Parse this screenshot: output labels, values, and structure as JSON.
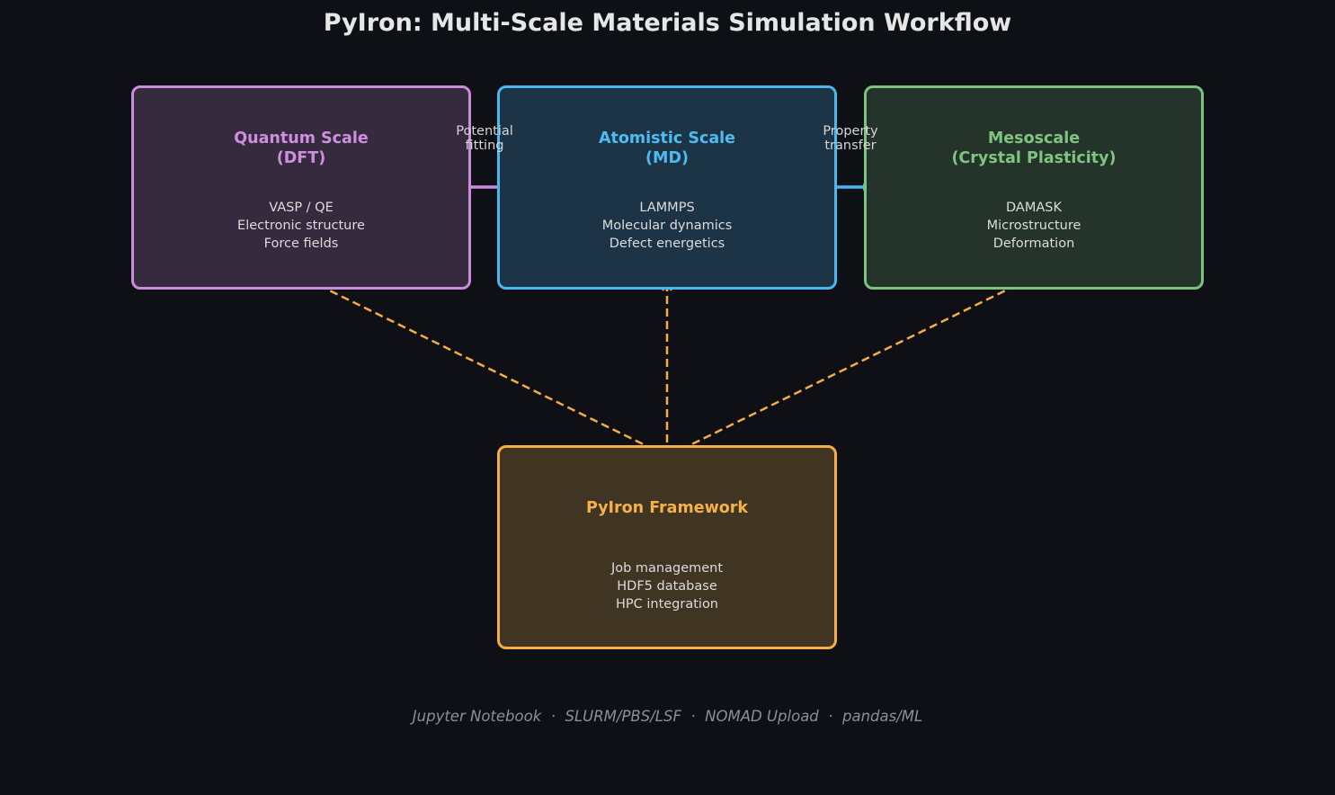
{
  "title": "PyIron: Multi-Scale Materials Simulation Workflow",
  "boxes": {
    "quantum": {
      "name": "Quantum Scale\n(DFT)",
      "lines": [
        "VASP / QE",
        "Electronic structure",
        "Force fields"
      ],
      "color": "#c98ddc"
    },
    "atomistic": {
      "name": "Atomistic Scale\n(MD)",
      "lines": [
        "LAMMPS",
        "Molecular dynamics",
        "Defect energetics"
      ],
      "color": "#48b8f0"
    },
    "meso": {
      "name": "Mesoscale\n(Crystal Plasticity)",
      "lines": [
        "DAMASK",
        "Microstructure",
        "Deformation"
      ],
      "color": "#7cc47e"
    },
    "pyiron": {
      "name": "PyIron Framework",
      "lines": [
        "Job management",
        "HDF5 database",
        "HPC integration"
      ],
      "color": "#f5ad44"
    }
  },
  "edges": {
    "quantum_to_atomistic": {
      "label": "Potential\nfitting"
    },
    "atomistic_to_meso": {
      "label": "Property\ntransfer"
    }
  },
  "footer": "Jupyter Notebook  ·  SLURM/PBS/LSF  ·  NOMAD Upload  ·  pandas/ML"
}
